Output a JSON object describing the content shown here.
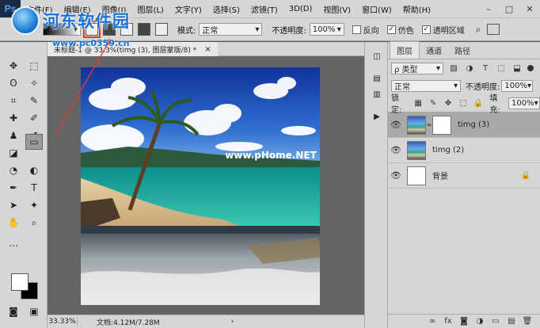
{
  "app": {
    "logo": "Ps"
  },
  "menu": [
    "文件(F)",
    "编辑(E)",
    "图像(I)",
    "图层(L)",
    "文字(Y)",
    "选择(S)",
    "滤镜(T)",
    "3D(D)",
    "视图(V)",
    "窗口(W)",
    "帮助(H)"
  ],
  "window_controls": [
    "–",
    "□",
    "✕"
  ],
  "watermark": {
    "text": "河东软件园",
    "url": "www.pc0359.cn"
  },
  "options": {
    "mode_label": "模式:",
    "mode_value": "正常",
    "opacity_label": "不透明度:",
    "opacity_value": "100%",
    "reverse_label": "反向",
    "dither_label": "仿色",
    "transparency_label": "透明区域"
  },
  "document": {
    "tab_label": "未标题-1 @ 33.3%(timg (3), 图层蒙版/8) *",
    "close": "×",
    "zoom": "33.33%",
    "doc_info": "文档:4.12M/7.28M",
    "image_watermark": "www.pHome.NET"
  },
  "layers_panel": {
    "tabs": [
      "图层",
      "通道",
      "路径"
    ],
    "filter_label": "ρ 类型",
    "blend_mode": "正常",
    "opacity_label": "不透明度:",
    "opacity_value": "100%",
    "lock_label": "锁定:",
    "fill_label": "填充:",
    "fill_value": "100%",
    "layers": [
      {
        "name": "timg (3)",
        "selected": true,
        "has_mask": true
      },
      {
        "name": "timg (2)",
        "selected": false,
        "has_mask": false
      },
      {
        "name": "背景",
        "selected": false,
        "locked": true
      }
    ],
    "footer_icons": [
      "link-icon",
      "fx-icon",
      "mask-icon",
      "adjustment-icon",
      "folder-icon",
      "new-layer-icon",
      "trash-icon"
    ]
  },
  "colors": {
    "panel": "#d6d6d6",
    "canvas": "#646464",
    "accent": "#1a72d0",
    "highlight": "#e03a2f"
  }
}
